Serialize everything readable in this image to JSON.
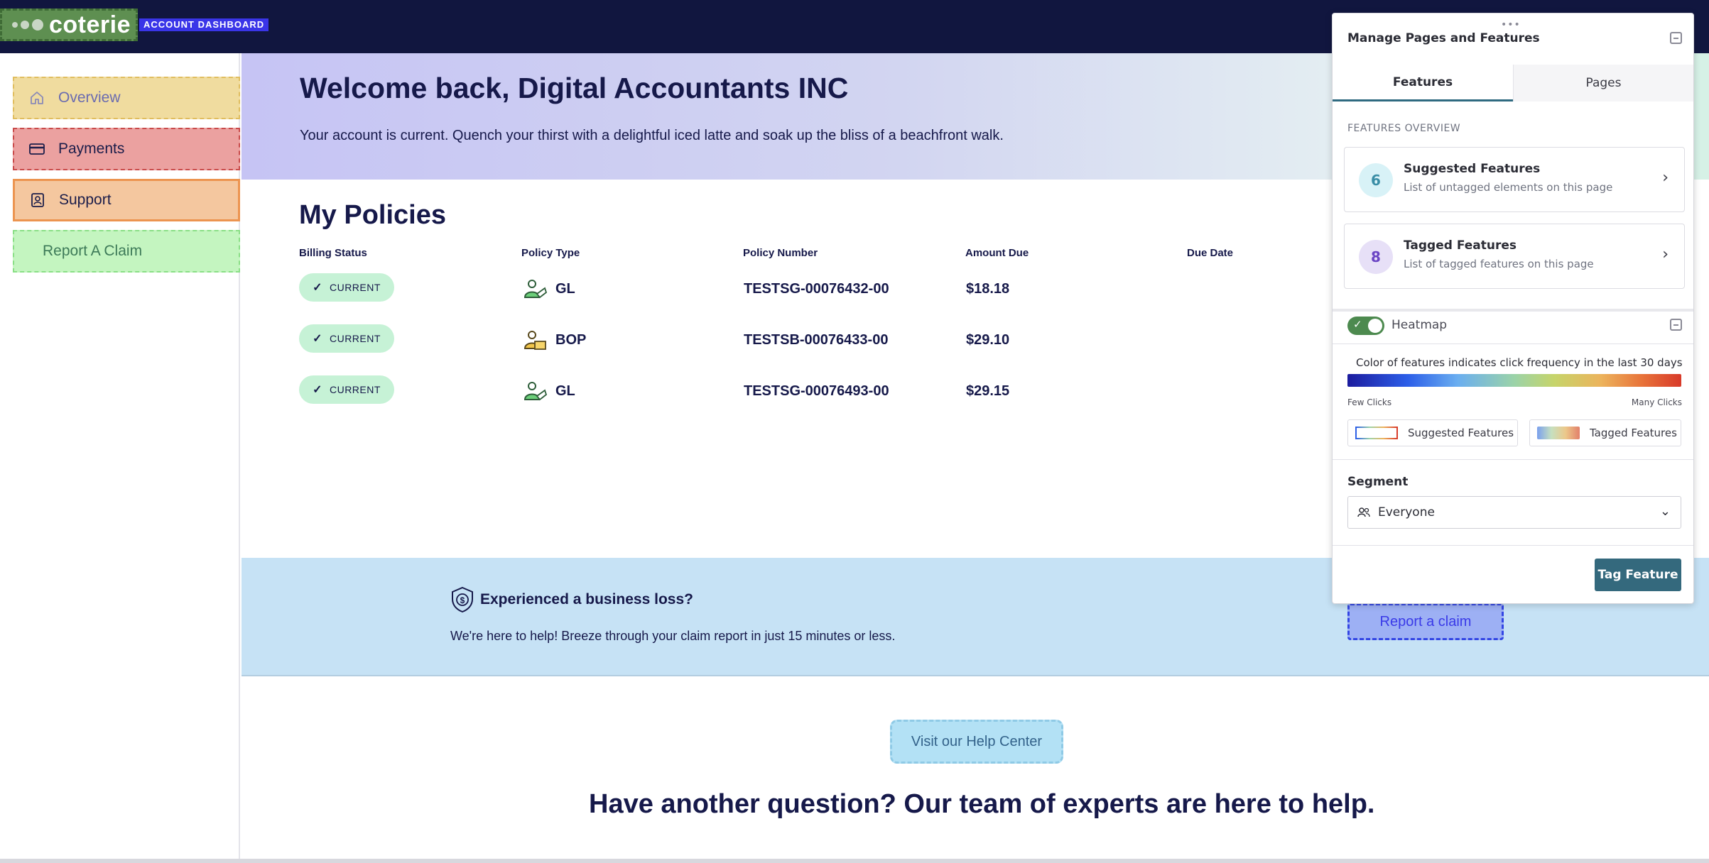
{
  "topbar": {
    "logo_text": "coterie",
    "badge": "ACCOUNT DASHBOARD"
  },
  "sidebar": {
    "items": [
      {
        "label": "Overview",
        "icon": "home-icon"
      },
      {
        "label": "Payments",
        "icon": "credit-card-icon"
      },
      {
        "label": "Support",
        "icon": "contact-card-icon"
      },
      {
        "label": "Report A Claim",
        "icon": ""
      }
    ]
  },
  "hero": {
    "title": "Welcome back, Digital Accountants INC",
    "message": "Your account is current. Quench your thirst with a delightful iced latte and soak up the bliss of a beachfront walk."
  },
  "policies": {
    "title": "My Policies",
    "columns": [
      "Billing Status",
      "Policy Type",
      "Policy Number",
      "Amount Due",
      "Due Date"
    ],
    "rows": [
      {
        "status": "CURRENT",
        "type": "GL",
        "number": "TESTSG-00076432-00",
        "amount": "$18.18",
        "due": ""
      },
      {
        "status": "CURRENT",
        "type": "BOP",
        "number": "TESTSB-00076433-00",
        "amount": "$29.10",
        "due": ""
      },
      {
        "status": "CURRENT",
        "type": "GL",
        "number": "TESTSG-00076493-00",
        "amount": "$29.15",
        "due": ""
      }
    ]
  },
  "claim_banner": {
    "title": "Experienced a business loss?",
    "text": "We're here to help! Breeze through your claim report in just 15 minutes or less.",
    "button": "Report a claim"
  },
  "help": {
    "button": "Visit our Help Center",
    "heading": "Have another question? Our team of experts are here to help."
  },
  "panel": {
    "drag_handle": "•••",
    "title": "Manage Pages and Features",
    "tabs": [
      "Features",
      "Pages"
    ],
    "overview_label": "FEATURES OVERVIEW",
    "cards": [
      {
        "count": "6",
        "title": "Suggested Features",
        "desc": "List of untagged elements on this page"
      },
      {
        "count": "8",
        "title": "Tagged Features",
        "desc": "List of tagged features on this page"
      }
    ],
    "heatmap": {
      "label": "Heatmap",
      "enabled": true,
      "description": "Color of features indicates click frequency in the last 30 days",
      "few": "Few Clicks",
      "many": "Many Clicks",
      "legend": [
        "Suggested Features",
        "Tagged Features"
      ]
    },
    "segment": {
      "label": "Segment",
      "value": "Everyone"
    },
    "tag_button": "Tag Feature"
  },
  "colors": {
    "topbar": "#11163f",
    "accent_teal": "#34697d",
    "status_green": "#c6f2d6",
    "banner_blue": "#c6e2f5"
  }
}
